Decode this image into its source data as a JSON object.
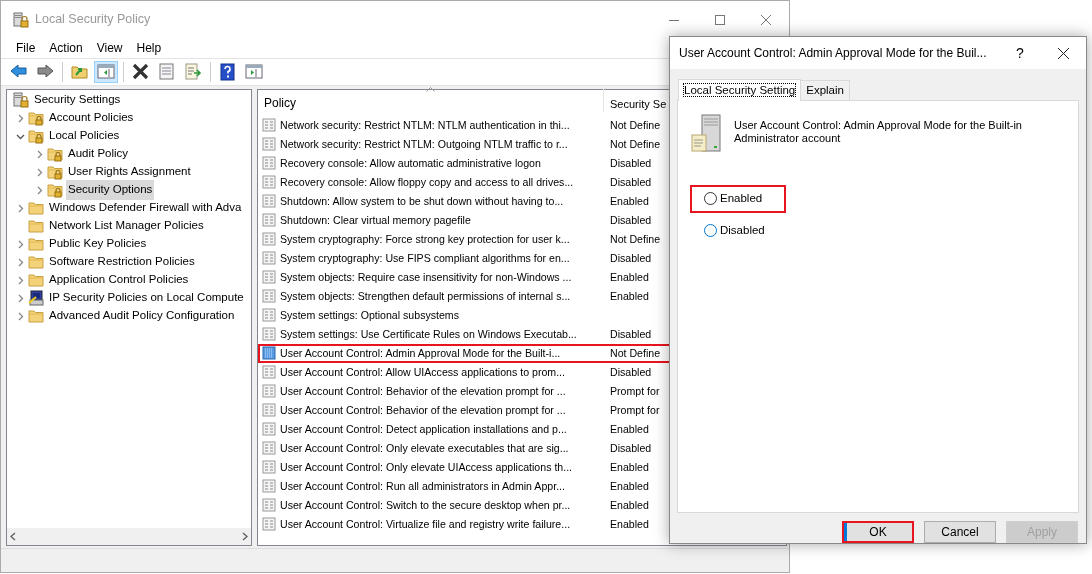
{
  "window": {
    "title": "Local Security Policy"
  },
  "menu": [
    {
      "label": "File"
    },
    {
      "label": "Action"
    },
    {
      "label": "View"
    },
    {
      "label": "Help"
    }
  ],
  "toolbar": [
    {
      "kind": "back",
      "pressed": false
    },
    {
      "kind": "forward",
      "pressed": false
    },
    {
      "kind": "separator"
    },
    {
      "kind": "up",
      "pressed": false
    },
    {
      "kind": "tree",
      "pressed": true
    },
    {
      "kind": "separator"
    },
    {
      "kind": "delete",
      "pressed": false
    },
    {
      "kind": "properties",
      "pressed": false
    },
    {
      "kind": "export",
      "pressed": false
    },
    {
      "kind": "separator"
    },
    {
      "kind": "help",
      "pressed": false
    },
    {
      "kind": "pane",
      "pressed": false
    }
  ],
  "tree": [
    {
      "label": "Security Settings",
      "kind": "root",
      "selected": false,
      "children": [
        {
          "label": "Account Policies",
          "kind": "locked-folder",
          "expandable": true,
          "expanded": false,
          "selected": false
        },
        {
          "label": "Local Policies",
          "kind": "locked-folder",
          "expandable": true,
          "expanded": true,
          "selected": false,
          "children": [
            {
              "label": "Audit Policy",
              "kind": "locked-folder",
              "expandable": true,
              "expanded": false,
              "selected": false
            },
            {
              "label": "User Rights Assignment",
              "kind": "locked-folder",
              "expandable": true,
              "expanded": false,
              "selected": false
            },
            {
              "label": "Security Options",
              "kind": "locked-folder",
              "expandable": true,
              "expanded": false,
              "selected": true
            }
          ]
        },
        {
          "label": "Windows Defender Firewall with Adva",
          "kind": "folder",
          "expandable": true,
          "expanded": false,
          "selected": false
        },
        {
          "label": "Network List Manager Policies",
          "kind": "folder",
          "expandable": false,
          "selected": false
        },
        {
          "label": "Public Key Policies",
          "kind": "folder",
          "expandable": true,
          "expanded": false,
          "selected": false
        },
        {
          "label": "Software Restriction Policies",
          "kind": "folder",
          "expandable": true,
          "expanded": false,
          "selected": false
        },
        {
          "label": "Application Control Policies",
          "kind": "folder",
          "expandable": true,
          "expanded": false,
          "selected": false
        },
        {
          "label": "IP Security Policies on Local Compute",
          "kind": "ip-policy",
          "expandable": true,
          "expanded": false,
          "selected": false
        },
        {
          "label": "Advanced Audit Policy Configuration",
          "kind": "folder",
          "expandable": true,
          "expanded": false,
          "selected": false
        }
      ]
    }
  ],
  "list": {
    "columns": [
      {
        "label": "Policy",
        "sorted": true
      },
      {
        "label": "Security Se",
        "sorted": false
      }
    ],
    "rows": [
      {
        "policy": "Network security: Restrict NTLM: NTLM authentication in thi...",
        "setting": "Not Define",
        "selected": false,
        "marked": false
      },
      {
        "policy": "Network security: Restrict NTLM: Outgoing NTLM traffic to r...",
        "setting": "Not Define",
        "selected": false,
        "marked": false
      },
      {
        "policy": "Recovery console: Allow automatic administrative logon",
        "setting": "Disabled",
        "selected": false,
        "marked": false
      },
      {
        "policy": "Recovery console: Allow floppy copy and access to all drives...",
        "setting": "Disabled",
        "selected": false,
        "marked": false
      },
      {
        "policy": "Shutdown: Allow system to be shut down without having to...",
        "setting": "Enabled",
        "selected": false,
        "marked": false
      },
      {
        "policy": "Shutdown: Clear virtual memory pagefile",
        "setting": "Disabled",
        "selected": false,
        "marked": false
      },
      {
        "policy": "System cryptography: Force strong key protection for user k...",
        "setting": "Not Define",
        "selected": false,
        "marked": false
      },
      {
        "policy": "System cryptography: Use FIPS compliant algorithms for en...",
        "setting": "Disabled",
        "selected": false,
        "marked": false
      },
      {
        "policy": "System objects: Require case insensitivity for non-Windows ...",
        "setting": "Enabled",
        "selected": false,
        "marked": false
      },
      {
        "policy": "System objects: Strengthen default permissions of internal s...",
        "setting": "Enabled",
        "selected": false,
        "marked": false
      },
      {
        "policy": "System settings: Optional subsystems",
        "selected": false,
        "marked": false
      },
      {
        "policy": "System settings: Use Certificate Rules on Windows Executab...",
        "setting": "Disabled",
        "selected": false,
        "marked": false
      },
      {
        "policy": "User Account Control: Admin Approval Mode for the Built-i...",
        "setting": "Not Define",
        "selected": true,
        "marked": true
      },
      {
        "policy": "User Account Control: Allow UIAccess applications to prom...",
        "setting": "Disabled",
        "selected": false,
        "marked": false
      },
      {
        "policy": "User Account Control: Behavior of the elevation prompt for ...",
        "setting": "Prompt for",
        "selected": false,
        "marked": false
      },
      {
        "policy": "User Account Control: Behavior of the elevation prompt for ...",
        "setting": "Prompt for",
        "selected": false,
        "marked": false
      },
      {
        "policy": "User Account Control: Detect application installations and p...",
        "setting": "Enabled",
        "selected": false,
        "marked": false
      },
      {
        "policy": "User Account Control: Only elevate executables that are sig...",
        "setting": "Disabled",
        "selected": false,
        "marked": false
      },
      {
        "policy": "User Account Control: Only elevate UIAccess applications th...",
        "setting": "Enabled",
        "selected": false,
        "marked": false
      },
      {
        "policy": "User Account Control: Run all administrators in Admin Appr...",
        "setting": "Enabled",
        "selected": false,
        "marked": false
      },
      {
        "policy": "User Account Control: Switch to the secure desktop when pr...",
        "setting": "Enabled",
        "selected": false,
        "marked": false
      },
      {
        "policy": "User Account Control: Virtualize file and registry write failure...",
        "setting": "Enabled",
        "selected": false,
        "marked": false
      }
    ]
  },
  "dialog": {
    "title": "User Account Control: Admin Approval Mode for the Buil...",
    "help": "?",
    "tabs": [
      {
        "label": "Local Security Setting",
        "selected": true
      },
      {
        "label": "Explain",
        "selected": false
      }
    ],
    "description": "User Account Control: Admin Approval Mode for the Built-in Administrator account",
    "options": [
      {
        "label": "Enabled",
        "checked": false,
        "hover": false,
        "marked": true
      },
      {
        "label": "Disabled",
        "checked": false,
        "hover": true,
        "marked": false
      }
    ],
    "buttons": [
      {
        "label": "OK",
        "default": true,
        "disabled": false,
        "marked": true
      },
      {
        "label": "Cancel",
        "default": false,
        "disabled": false,
        "marked": false
      },
      {
        "label": "Apply",
        "default": false,
        "disabled": true,
        "marked": false
      }
    ]
  }
}
